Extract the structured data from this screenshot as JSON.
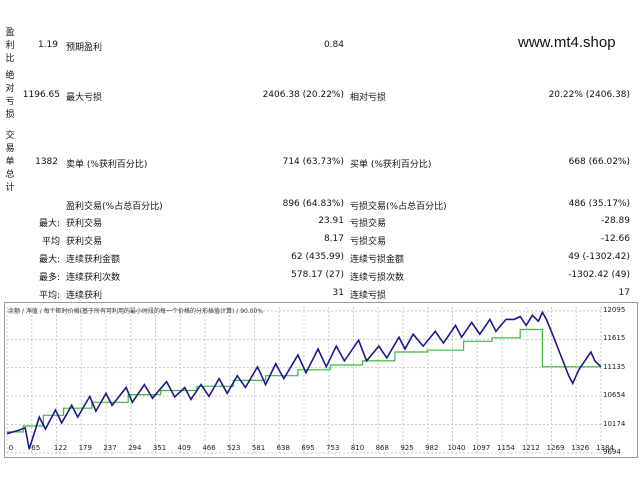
{
  "watermark": "www.mt4.shop",
  "sections": [
    {
      "label_chars": [
        "盈",
        "利",
        "比"
      ],
      "top": 27
    },
    {
      "label_chars": [
        "绝",
        "对",
        "亏",
        "损"
      ],
      "top": 70
    },
    {
      "label_chars": [
        "交",
        "易",
        "单",
        "总",
        "计"
      ],
      "top": 130
    }
  ],
  "rows": {
    "r1": {
      "left_val": "1.19",
      "label1": "预期盈利",
      "val1": "0.84"
    },
    "r2": {
      "left_val": "1196.65",
      "label1": "最大亏损",
      "val1": "2406.38 (20.22%)",
      "label2": "相对亏损",
      "val2": "20.22% (2406.38)"
    },
    "r3": {
      "left_val": "1382",
      "label1": "卖单 (%获利百分比)",
      "val1": "714 (63.73%)",
      "label2": "买单 (%获利百分比)",
      "val2": "668 (66.02%)"
    },
    "r4": {
      "label1": "盈利交易(%占总百分比)",
      "val1": "896 (64.83%)",
      "label2": "亏损交易(%占总百分比)",
      "val2": "486 (35.17%)"
    },
    "r5": {
      "prefix": "最大:",
      "label1": "获利交易",
      "val1": "23.91",
      "label2": "亏损交易",
      "val2": "-28.89"
    },
    "r6": {
      "prefix": "平均",
      "label1": "获利交易",
      "val1": "8.17",
      "label2": "亏损交易",
      "val2": "-12.66"
    },
    "r7": {
      "prefix": "最大:",
      "label1": "连续获利金额",
      "val1": "62 (435.99)",
      "label2": "连续亏损金额",
      "val2": "49 (-1302.42)"
    },
    "r8": {
      "prefix": "最多:",
      "label1": "连续获利次数",
      "val1": "578.17 (27)",
      "label2": "连续亏损次数",
      "val2": "-1302.42 (49)"
    },
    "r9": {
      "prefix": "平均:",
      "label1": "连续获利",
      "val1": "31",
      "label2": "连续亏损",
      "val2": "17"
    }
  },
  "chart_legend": "余额 / 净值 / 每个柜时价格(基于所有可利用的最小时段的每一个价格的分形插值计算) / 90.00%",
  "chart_data": {
    "type": "line",
    "x_ticks": [
      "0",
      "65",
      "122",
      "179",
      "237",
      "294",
      "351",
      "409",
      "466",
      "523",
      "581",
      "638",
      "695",
      "753",
      "810",
      "868",
      "925",
      "982",
      "1040",
      "1097",
      "1154",
      "1212",
      "1269",
      "1326",
      "1384"
    ],
    "y_ticks": [
      "12095",
      "11615",
      "11135",
      "10654",
      "10174",
      "9694"
    ],
    "ylim": [
      9694,
      12160
    ],
    "xlim": [
      0,
      1420
    ],
    "series": [
      {
        "name": "余额",
        "color": "#1a1a8c",
        "width": 1.6,
        "points": [
          [
            0,
            10020
          ],
          [
            30,
            10080
          ],
          [
            45,
            10120
          ],
          [
            55,
            9760
          ],
          [
            80,
            10300
          ],
          [
            95,
            10100
          ],
          [
            120,
            10420
          ],
          [
            135,
            10200
          ],
          [
            160,
            10500
          ],
          [
            175,
            10300
          ],
          [
            205,
            10650
          ],
          [
            220,
            10400
          ],
          [
            245,
            10700
          ],
          [
            260,
            10500
          ],
          [
            295,
            10800
          ],
          [
            310,
            10550
          ],
          [
            340,
            10850
          ],
          [
            360,
            10620
          ],
          [
            395,
            10900
          ],
          [
            415,
            10640
          ],
          [
            440,
            10800
          ],
          [
            455,
            10600
          ],
          [
            480,
            10850
          ],
          [
            500,
            10650
          ],
          [
            525,
            10950
          ],
          [
            545,
            10700
          ],
          [
            570,
            11000
          ],
          [
            590,
            10800
          ],
          [
            620,
            11150
          ],
          [
            640,
            10850
          ],
          [
            665,
            11200
          ],
          [
            685,
            10950
          ],
          [
            720,
            11350
          ],
          [
            740,
            11050
          ],
          [
            770,
            11450
          ],
          [
            790,
            11150
          ],
          [
            815,
            11500
          ],
          [
            835,
            11250
          ],
          [
            870,
            11600
          ],
          [
            890,
            11250
          ],
          [
            920,
            11500
          ],
          [
            940,
            11300
          ],
          [
            970,
            11650
          ],
          [
            985,
            11450
          ],
          [
            1005,
            11700
          ],
          [
            1030,
            11500
          ],
          [
            1060,
            11750
          ],
          [
            1080,
            11550
          ],
          [
            1110,
            11850
          ],
          [
            1125,
            11650
          ],
          [
            1150,
            11900
          ],
          [
            1170,
            11700
          ],
          [
            1195,
            11950
          ],
          [
            1210,
            11750
          ],
          [
            1235,
            11950
          ],
          [
            1255,
            11950
          ],
          [
            1270,
            12000
          ],
          [
            1285,
            11850
          ],
          [
            1300,
            12020
          ],
          [
            1315,
            11920
          ],
          [
            1325,
            12070
          ],
          [
            1335,
            11950
          ],
          [
            1350,
            11700
          ],
          [
            1370,
            11350
          ],
          [
            1390,
            11000
          ],
          [
            1400,
            10870
          ],
          [
            1415,
            11100
          ],
          [
            1430,
            11250
          ],
          [
            1445,
            11400
          ],
          [
            1455,
            11250
          ],
          [
            1470,
            11150
          ]
        ]
      },
      {
        "name": "净值",
        "color": "#3cb83c",
        "width": 1.2,
        "points": [
          [
            0,
            10050
          ],
          [
            40,
            10050
          ],
          [
            40,
            10150
          ],
          [
            90,
            10150
          ],
          [
            90,
            10330
          ],
          [
            140,
            10330
          ],
          [
            140,
            10450
          ],
          [
            210,
            10450
          ],
          [
            210,
            10550
          ],
          [
            300,
            10550
          ],
          [
            300,
            10680
          ],
          [
            380,
            10680
          ],
          [
            380,
            10750
          ],
          [
            470,
            10750
          ],
          [
            470,
            10820
          ],
          [
            560,
            10820
          ],
          [
            560,
            10920
          ],
          [
            640,
            10920
          ],
          [
            640,
            11000
          ],
          [
            720,
            11000
          ],
          [
            720,
            11100
          ],
          [
            800,
            11100
          ],
          [
            800,
            11180
          ],
          [
            880,
            11180
          ],
          [
            880,
            11250
          ],
          [
            960,
            11250
          ],
          [
            960,
            11400
          ],
          [
            1040,
            11400
          ],
          [
            1040,
            11430
          ],
          [
            1130,
            11430
          ],
          [
            1130,
            11580
          ],
          [
            1200,
            11580
          ],
          [
            1200,
            11640
          ],
          [
            1270,
            11640
          ],
          [
            1270,
            11780
          ],
          [
            1325,
            11780
          ],
          [
            1325,
            11150
          ],
          [
            1470,
            11150
          ]
        ]
      }
    ]
  }
}
